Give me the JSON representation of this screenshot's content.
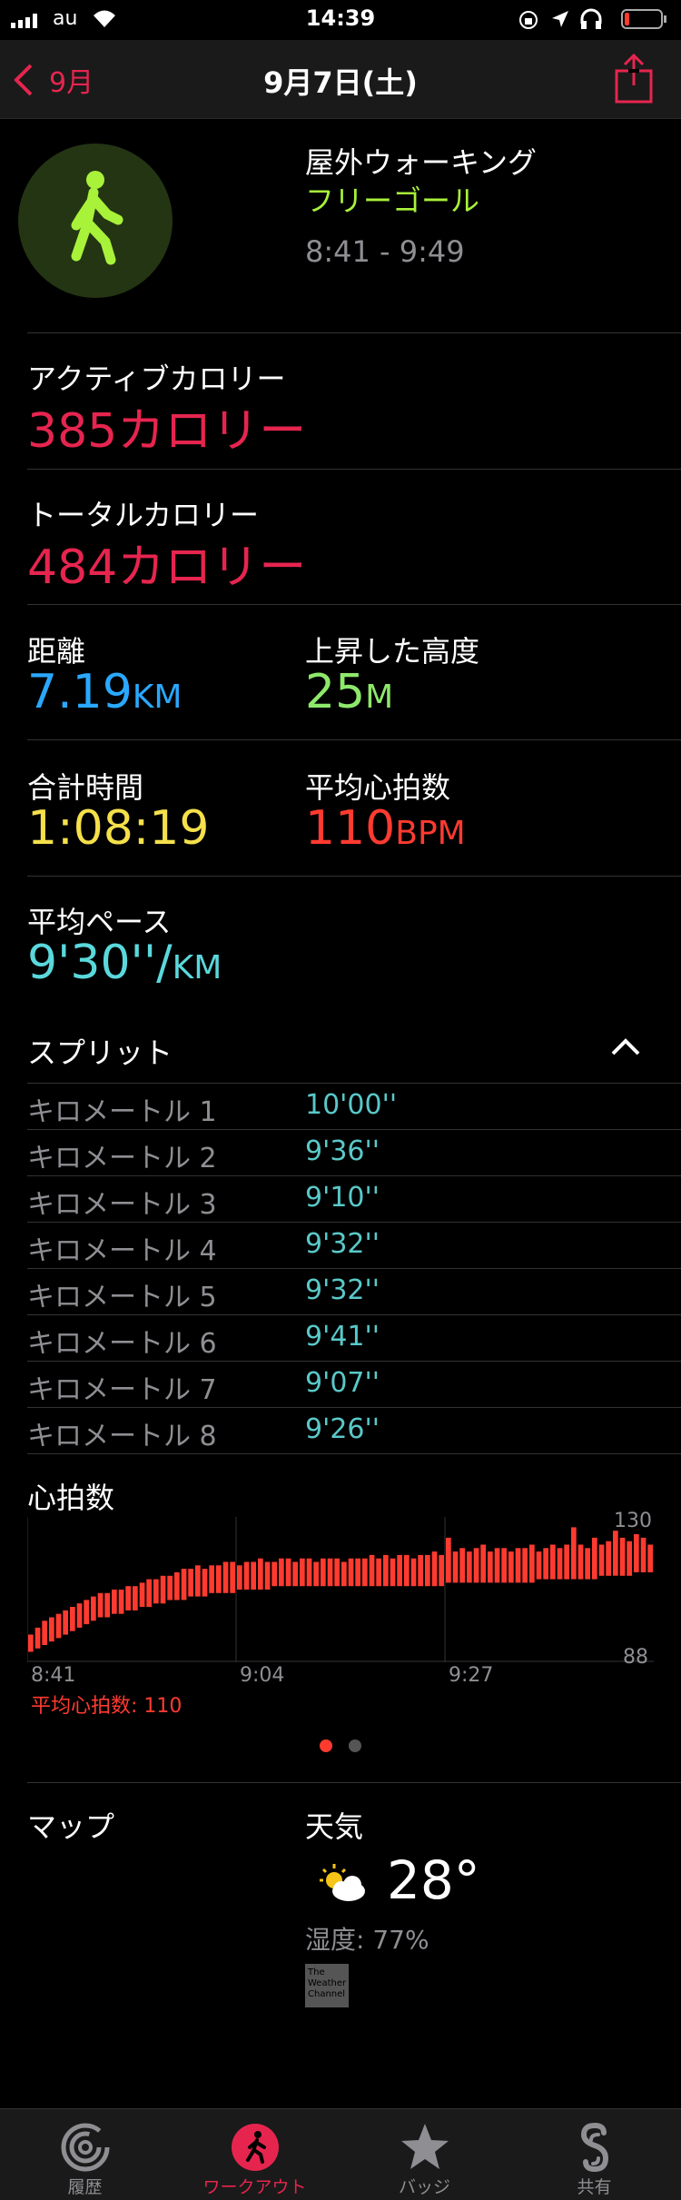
{
  "status": {
    "carrier": "au",
    "time": "14:39"
  },
  "nav": {
    "back_label": "9月",
    "title": "9月7日(土)"
  },
  "workout": {
    "name": "屋外ウォーキング",
    "goal": "フリーゴール",
    "time_range": "8:41 - 9:49"
  },
  "metrics": {
    "active_cal_label": "アクティブカロリー",
    "active_cal_value": "385カロリー",
    "total_cal_label": "トータルカロリー",
    "total_cal_value": "484カロリー",
    "distance_label": "距離",
    "distance_value": "7.19",
    "distance_unit": "KM",
    "elevation_label": "上昇した高度",
    "elevation_value": "25",
    "elevation_unit": "M",
    "duration_label": "合計時間",
    "duration_value": "1:08:19",
    "avg_hr_label": "平均心拍数",
    "avg_hr_value": "110",
    "avg_hr_unit": "BPM",
    "pace_label": "平均ペース",
    "pace_value": "9'30''/",
    "pace_unit": "KM"
  },
  "splits": {
    "title": "スプリット",
    "rows": [
      {
        "label": "キロメートル 1",
        "value": "10'00''"
      },
      {
        "label": "キロメートル 2",
        "value": "9'36''"
      },
      {
        "label": "キロメートル 3",
        "value": "9'10''"
      },
      {
        "label": "キロメートル 4",
        "value": "9'32''"
      },
      {
        "label": "キロメートル 5",
        "value": "9'32''"
      },
      {
        "label": "キロメートル 6",
        "value": "9'41''"
      },
      {
        "label": "キロメートル 7",
        "value": "9'07''"
      },
      {
        "label": "キロメートル 8",
        "value": "9'26''"
      }
    ]
  },
  "heart_rate": {
    "title": "心拍数",
    "y_max_label": "130",
    "y_min_label": "88",
    "x_labels": [
      "8:41",
      "9:04",
      "9:27"
    ],
    "avg_label": "平均心拍数: 110"
  },
  "chart_data": {
    "type": "bar",
    "title": "心拍数",
    "xlabel": "",
    "ylabel": "",
    "ylim": [
      88,
      130
    ],
    "x_ticks": [
      "8:41",
      "9:04",
      "9:27"
    ],
    "values_low": [
      91,
      92,
      93,
      94,
      95,
      96,
      97,
      98,
      99,
      100,
      101,
      101,
      102,
      102,
      103,
      103,
      104,
      104,
      105,
      105,
      106,
      106,
      106,
      107,
      107,
      107,
      108,
      108,
      108,
      108,
      109,
      109,
      109,
      109,
      109,
      110,
      110,
      110,
      110,
      110,
      110,
      110,
      110,
      110,
      110,
      110,
      110,
      110,
      110,
      110,
      110,
      110,
      110,
      110,
      110,
      110,
      110,
      110,
      110,
      110,
      111,
      111,
      111,
      111,
      111,
      111,
      111,
      111,
      111,
      111,
      111,
      111,
      111,
      112,
      112,
      112,
      112,
      112,
      112,
      112,
      112,
      112,
      113,
      113,
      113,
      113,
      113,
      114,
      114,
      114
    ],
    "values_high": [
      96,
      98,
      100,
      101,
      102,
      103,
      104,
      105,
      106,
      107,
      108,
      108,
      109,
      109,
      110,
      110,
      111,
      112,
      112,
      113,
      113,
      114,
      115,
      115,
      116,
      115,
      116,
      116,
      117,
      117,
      116,
      117,
      117,
      118,
      117,
      117,
      118,
      118,
      117,
      118,
      118,
      117,
      118,
      118,
      118,
      117,
      118,
      118,
      118,
      119,
      118,
      119,
      118,
      119,
      119,
      118,
      119,
      119,
      120,
      119,
      124,
      120,
      121,
      120,
      121,
      122,
      120,
      121,
      121,
      120,
      121,
      121,
      122,
      120,
      121,
      122,
      121,
      122,
      127,
      122,
      121,
      124,
      122,
      123,
      126,
      124,
      123,
      125,
      124,
      122
    ]
  },
  "pager": {
    "active": 0,
    "count": 2
  },
  "map": {
    "title": "マップ"
  },
  "weather": {
    "title": "天気",
    "temp": "28°",
    "humidity": "湿度: 77%",
    "logo": "The Weather Channel"
  },
  "tabs": [
    {
      "label": "履歴",
      "icon": "history-rings-icon"
    },
    {
      "label": "ワークアウト",
      "icon": "workout-runner-icon"
    },
    {
      "label": "バッジ",
      "icon": "badge-star-icon"
    },
    {
      "label": "共有",
      "icon": "share-icon"
    }
  ],
  "colors": {
    "accent": "#e6254f",
    "walk_green": "#a8f23a",
    "distance_blue": "#2aa8ff",
    "elev_green": "#8ee86b",
    "duration_yellow": "#f5e04a",
    "hr_red": "#ff3b30",
    "pace_cyan": "#5ad8dc"
  }
}
